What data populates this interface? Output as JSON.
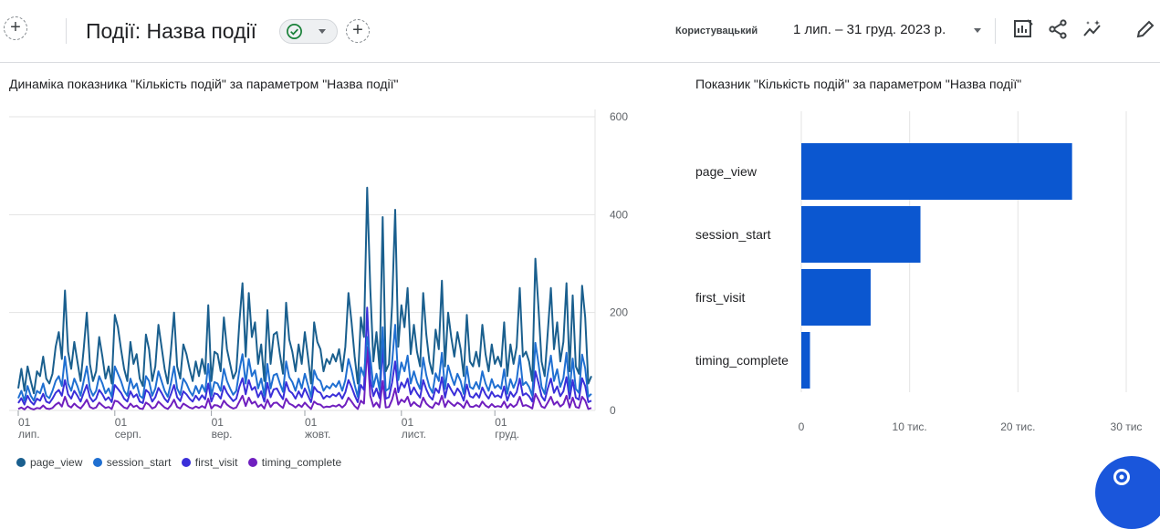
{
  "header": {
    "title": "Події: Назва події",
    "compare_label": "Користувацький",
    "date_range": "1 лип. – 31 груд. 2023 р.",
    "icons": [
      "add-icon",
      "check-circle-icon",
      "add-comparison-icon",
      "customize-report-icon",
      "share-icon",
      "insights-icon",
      "edit-icon"
    ]
  },
  "colors": {
    "page_view": "#1a5f8e",
    "session_start": "#1f6fd1",
    "first_visit": "#3a2fd9",
    "timing_complete": "#6f1fbf",
    "bar": "#0b57d0"
  },
  "line_chart": {
    "title": "Динаміка показника \"Кількість подій\" за параметром \"Назва події\""
  },
  "bar_chart": {
    "title": "Показник \"Кількість подій\" за параметром \"Назва події\""
  },
  "chart_data": [
    {
      "type": "line",
      "title": "Динаміка показника \"Кількість подій\" за параметром \"Назва події\"",
      "x_start": "2023-07-01",
      "x_end": "2023-12-31",
      "x_ticks": [
        {
          "day": 1,
          "date": "01",
          "month": "лип."
        },
        {
          "day": 32,
          "date": "01",
          "month": "серп."
        },
        {
          "day": 63,
          "date": "01",
          "month": "вер."
        },
        {
          "day": 93,
          "date": "01",
          "month": "жовт."
        },
        {
          "day": 124,
          "date": "01",
          "month": "лист."
        },
        {
          "day": 154,
          "date": "01",
          "month": "груд."
        }
      ],
      "y_ticks": [
        0,
        200,
        400,
        600
      ],
      "ylim": [
        0,
        600
      ],
      "grid": true,
      "legend_position": "bottom",
      "series": [
        {
          "name": "page_view",
          "values": [
            45,
            85,
            40,
            90,
            60,
            35,
            80,
            70,
            110,
            65,
            55,
            75,
            130,
            160,
            105,
            245,
            120,
            85,
            140,
            100,
            60,
            125,
            200,
            95,
            60,
            80,
            150,
            110,
            65,
            90,
            55,
            195,
            170,
            125,
            85,
            60,
            140,
            95,
            115,
            65,
            50,
            155,
            125,
            60,
            90,
            175,
            130,
            85,
            55,
            120,
            200,
            90,
            65,
            135,
            115,
            85,
            60,
            100,
            70,
            105,
            75,
            215,
            60,
            120,
            115,
            80,
            190,
            125,
            95,
            65,
            80,
            180,
            260,
            110,
            240,
            150,
            180,
            95,
            135,
            60,
            205,
            95,
            155,
            160,
            115,
            75,
            220,
            145,
            120,
            80,
            135,
            95,
            160,
            110,
            55,
            180,
            140,
            125,
            80,
            105,
            95,
            115,
            100,
            125,
            80,
            130,
            240,
            180,
            110,
            55,
            190,
            150,
            455,
            250,
            100,
            160,
            85,
            395,
            80,
            95,
            215,
            410,
            130,
            215,
            170,
            250,
            115,
            175,
            120,
            90,
            240,
            155,
            100,
            75,
            165,
            125,
            265,
            90,
            200,
            150,
            110,
            160,
            125,
            70,
            195,
            100,
            90,
            120,
            90,
            175,
            115,
            80,
            135,
            95,
            110,
            90,
            180,
            70,
            135,
            95,
            130,
            250,
            110,
            120,
            100,
            60,
            310,
            210,
            100,
            70,
            160,
            250,
            125,
            180,
            100,
            140,
            260,
            80,
            235,
            90,
            75,
            255,
            190,
            55,
            70
          ]
        },
        {
          "name": "session_start",
          "values": [
            25,
            40,
            20,
            50,
            30,
            20,
            40,
            35,
            55,
            30,
            25,
            40,
            60,
            70,
            50,
            110,
            55,
            40,
            65,
            50,
            30,
            60,
            90,
            45,
            30,
            40,
            70,
            55,
            35,
            45,
            28,
            90,
            75,
            60,
            40,
            30,
            65,
            45,
            55,
            30,
            25,
            70,
            60,
            30,
            45,
            80,
            60,
            40,
            28,
            55,
            90,
            45,
            32,
            65,
            55,
            40,
            30,
            50,
            35,
            52,
            38,
            95,
            30,
            58,
            55,
            40,
            85,
            60,
            45,
            32,
            40,
            82,
            115,
            55,
            105,
            70,
            82,
            45,
            65,
            30,
            95,
            45,
            72,
            75,
            55,
            38,
            100,
            68,
            58,
            40,
            65,
            45,
            75,
            52,
            28,
            82,
            65,
            60,
            40,
            50,
            45,
            55,
            48,
            60,
            40,
            62,
            105,
            82,
            52,
            28,
            88,
            70,
            150,
            110,
            48,
            75,
            42,
            170,
            40,
            45,
            98,
            175,
            62,
            98,
            80,
            112,
            55,
            80,
            58,
            44,
            108,
            72,
            48,
            36,
            76,
            60,
            118,
            44,
            92,
            70,
            52,
            75,
            60,
            34,
            90,
            48,
            44,
            58,
            44,
            80,
            55,
            40,
            64,
            46,
            52,
            44,
            84,
            34,
            64,
            46,
            62,
            112,
            52,
            58,
            48,
            30,
            138,
            96,
            48,
            34,
            76,
            112,
            60,
            84,
            48,
            66,
            118,
            40,
            106,
            44,
            36,
            114,
            86,
            28,
            34
          ]
        },
        {
          "name": "first_visit",
          "values": [
            15,
            25,
            12,
            30,
            18,
            12,
            24,
            20,
            34,
            18,
            15,
            24,
            36,
            42,
            30,
            62,
            33,
            24,
            40,
            30,
            18,
            36,
            52,
            27,
            18,
            24,
            42,
            33,
            21,
            27,
            17,
            52,
            44,
            36,
            24,
            18,
            39,
            27,
            33,
            18,
            15,
            42,
            36,
            18,
            27,
            46,
            36,
            24,
            17,
            33,
            52,
            27,
            19,
            39,
            33,
            24,
            18,
            30,
            21,
            31,
            23,
            55,
            18,
            35,
            33,
            24,
            50,
            36,
            27,
            19,
            24,
            48,
            66,
            33,
            62,
            42,
            48,
            27,
            39,
            18,
            56,
            27,
            43,
            45,
            33,
            23,
            58,
            40,
            35,
            24,
            39,
            27,
            45,
            31,
            17,
            48,
            39,
            36,
            24,
            30,
            27,
            33,
            29,
            36,
            24,
            37,
            62,
            48,
            31,
            17,
            52,
            42,
            210,
            64,
            29,
            45,
            25,
            130,
            24,
            27,
            57,
            100,
            37,
            57,
            47,
            65,
            33,
            47,
            35,
            26,
            62,
            43,
            29,
            22,
            45,
            36,
            68,
            26,
            54,
            42,
            31,
            45,
            36,
            20,
            53,
            29,
            26,
            35,
            26,
            47,
            33,
            24,
            38,
            28,
            31,
            26,
            49,
            20,
            38,
            28,
            37,
            65,
            31,
            35,
            29,
            18,
            80,
            56,
            29,
            20,
            45,
            65,
            36,
            49,
            29,
            39,
            68,
            24,
            62,
            26,
            22,
            66,
            50,
            17,
            20
          ]
        },
        {
          "name": "timing_complete",
          "values": [
            3,
            6,
            2,
            8,
            4,
            2,
            5,
            4,
            10,
            4,
            3,
            5,
            12,
            16,
            8,
            28,
            10,
            6,
            14,
            8,
            4,
            12,
            22,
            7,
            4,
            6,
            16,
            10,
            5,
            7,
            3,
            20,
            18,
            12,
            6,
            4,
            14,
            7,
            10,
            4,
            3,
            16,
            12,
            4,
            7,
            18,
            12,
            6,
            3,
            10,
            22,
            7,
            4,
            14,
            10,
            6,
            4,
            8,
            5,
            9,
            5,
            24,
            4,
            11,
            10,
            6,
            20,
            12,
            7,
            4,
            6,
            18,
            30,
            9,
            26,
            14,
            18,
            7,
            12,
            4,
            22,
            7,
            15,
            16,
            10,
            5,
            24,
            14,
            11,
            6,
            12,
            7,
            16,
            9,
            3,
            18,
            13,
            12,
            6,
            8,
            7,
            10,
            8,
            12,
            6,
            12,
            26,
            18,
            9,
            3,
            20,
            14,
            130,
            30,
            8,
            16,
            6,
            60,
            6,
            7,
            22,
            45,
            12,
            22,
            17,
            28,
            9,
            17,
            11,
            7,
            26,
            14,
            8,
            5,
            16,
            12,
            30,
            7,
            20,
            14,
            9,
            16,
            12,
            5,
            20,
            8,
            7,
            11,
            7,
            18,
            10,
            6,
            13,
            7,
            9,
            7,
            18,
            5,
            13,
            7,
            12,
            28,
            9,
            11,
            8,
            4,
            34,
            22,
            8,
            5,
            16,
            28,
            12,
            18,
            8,
            13,
            30,
            6,
            26,
            7,
            5,
            28,
            20,
            3,
            5
          ]
        }
      ]
    },
    {
      "type": "bar",
      "title": "Показник \"Кількість подій\" за параметром \"Назва події\"",
      "orientation": "horizontal",
      "categories": [
        "page_view",
        "session_start",
        "first_visit",
        "timing_complete"
      ],
      "values": [
        25000,
        11000,
        6400,
        800
      ],
      "xlim": [
        0,
        30000
      ],
      "x_ticks": [
        "0",
        "10 тис.",
        "20 тис.",
        "30 тис"
      ],
      "grid": true
    }
  ]
}
